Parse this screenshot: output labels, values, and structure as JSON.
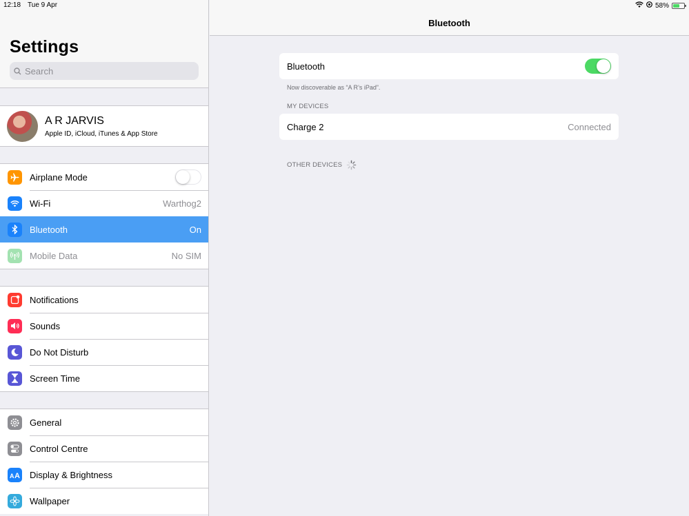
{
  "status": {
    "time": "12:18",
    "date": "Tue 9 Apr",
    "battery": "58%",
    "battery_level": 0.58
  },
  "sidebar": {
    "title": "Settings",
    "search_placeholder": "Search",
    "profile": {
      "name": "A R JARVIS",
      "subtitle": "Apple ID, iCloud, iTunes & App Store"
    },
    "group1": [
      {
        "label": "Airplane Mode",
        "value": "",
        "icon": "airplane-icon",
        "color": "#ff9500"
      },
      {
        "label": "Wi-Fi",
        "value": "Warthog2",
        "icon": "wifi-icon",
        "color": "#1a82fb"
      },
      {
        "label": "Bluetooth",
        "value": "On",
        "icon": "bluetooth-icon",
        "color": "#1a82fb"
      },
      {
        "label": "Mobile Data",
        "value": "No SIM",
        "icon": "antenna-icon",
        "color": "#a3e2b1"
      }
    ],
    "group2": [
      {
        "label": "Notifications",
        "icon": "notifications-icon",
        "color": "#ff3b30"
      },
      {
        "label": "Sounds",
        "icon": "speaker-icon",
        "color": "#ff2d55"
      },
      {
        "label": "Do Not Disturb",
        "icon": "moon-icon",
        "color": "#5856d6"
      },
      {
        "label": "Screen Time",
        "icon": "hourglass-icon",
        "color": "#5856d6"
      }
    ],
    "group3": [
      {
        "label": "General",
        "icon": "gear-icon",
        "color": "#8e8e93"
      },
      {
        "label": "Control Centre",
        "icon": "switches-icon",
        "color": "#8e8e93"
      },
      {
        "label": "Display & Brightness",
        "icon": "text-size-icon",
        "color": "#1a82fb"
      },
      {
        "label": "Wallpaper",
        "icon": "flower-icon",
        "color": "#34aadc"
      }
    ]
  },
  "detail": {
    "title": "Bluetooth",
    "toggle_label": "Bluetooth",
    "toggle_on": true,
    "discoverable_note": "Now discoverable as “A R’s iPad”.",
    "my_devices_header": "MY DEVICES",
    "devices": [
      {
        "name": "Charge 2",
        "status": "Connected"
      }
    ],
    "other_devices_header": "OTHER DEVICES"
  }
}
